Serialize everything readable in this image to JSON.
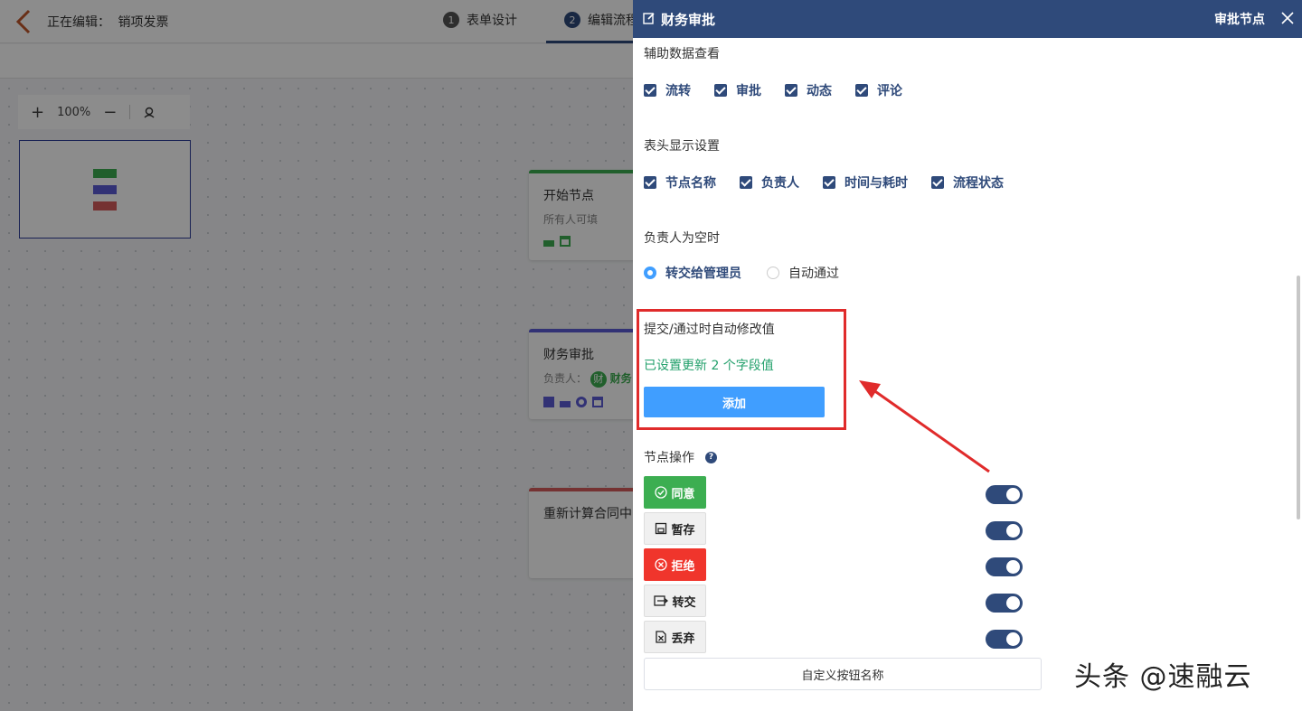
{
  "editor": {
    "editing_prefix": "正在编辑：",
    "form_name": "销项发票",
    "steps": [
      {
        "num": "1",
        "label": "表单设计"
      },
      {
        "num": "2",
        "label": "编辑流程"
      }
    ],
    "zoom_level": "100%",
    "nodes": [
      {
        "title": "开始节点",
        "sub": "所有人可填",
        "color": "#3cae51"
      },
      {
        "title": "财务审批",
        "sub": "负责人：",
        "avatar_char": "财",
        "assignee": "财务",
        "color": "#5b5bd6"
      },
      {
        "title": "重新计算合同中",
        "sub": "",
        "color": "#d65b5b"
      }
    ]
  },
  "drawer": {
    "title": "财务审批",
    "right_label": "审批节点",
    "aux_data": {
      "label": "辅助数据查看",
      "options": [
        "流转",
        "审批",
        "动态",
        "评论"
      ]
    },
    "header_display": {
      "label": "表头显示设置",
      "options": [
        "节点名称",
        "负责人",
        "时间与耗时",
        "流程状态"
      ]
    },
    "empty_assignee": {
      "label": "负责人为空时",
      "options": [
        {
          "label": "转交给管理员",
          "checked": true
        },
        {
          "label": "自动通过",
          "checked": false
        }
      ]
    },
    "auto_modify": {
      "label": "提交/通过时自动修改值",
      "status": "已设置更新 2 个字段值",
      "add_button": "添加"
    },
    "node_ops": {
      "label": "节点操作",
      "help": "?",
      "buttons": [
        {
          "label": "同意",
          "style": "green",
          "icon": "check-circle-icon",
          "enabled": true
        },
        {
          "label": "暂存",
          "style": "plain",
          "icon": "save-icon",
          "enabled": true
        },
        {
          "label": "拒绝",
          "style": "red",
          "icon": "x-circle-icon",
          "enabled": true
        },
        {
          "label": "转交",
          "style": "plain",
          "icon": "transfer-icon",
          "enabled": true
        },
        {
          "label": "丢弃",
          "style": "plain",
          "icon": "discard-icon",
          "enabled": true
        }
      ],
      "custom_button": "自定义按钮名称"
    }
  },
  "colors": {
    "primary": "#2f4a7a",
    "accent_blue": "#409eff",
    "success_green": "#22a06b",
    "annotation_red": "#e02b2b"
  },
  "watermark": "头条 @速融云"
}
